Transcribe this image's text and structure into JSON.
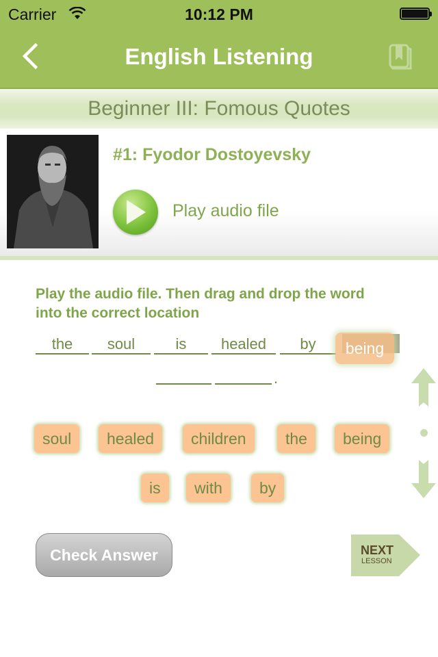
{
  "status_bar": {
    "carrier": "Carrier",
    "time": "10:12 PM"
  },
  "nav": {
    "title": "English Listening",
    "back_icon": "chevron-left-icon",
    "bookmark_icon": "book-bookmark-icon"
  },
  "subheader": {
    "title": "Beginner III: Fomous Quotes"
  },
  "lesson": {
    "title": "#1: Fyodor Dostoyevsky",
    "play_label": "Play audio file",
    "portrait": "Fyodor Dostoyevsky portrait"
  },
  "exercise": {
    "instructions": "Play the audio file. Then drag and drop the word into the correct location",
    "blanks": [
      "the",
      "soul",
      "is",
      "healed",
      "by",
      "",
      "",
      ""
    ],
    "end_punctuation": ".",
    "dragging_word": "being",
    "word_bank": [
      "soul",
      "healed",
      "children",
      "the",
      "being",
      "is",
      "with",
      "by"
    ]
  },
  "actions": {
    "check_answer": "Check Answer",
    "next_line1": "NEXT",
    "next_line2": "LESSON"
  },
  "colors": {
    "nav_green": "#9fbf5a",
    "text_green": "#7fa54a",
    "tile_orange": "#fcc493"
  }
}
